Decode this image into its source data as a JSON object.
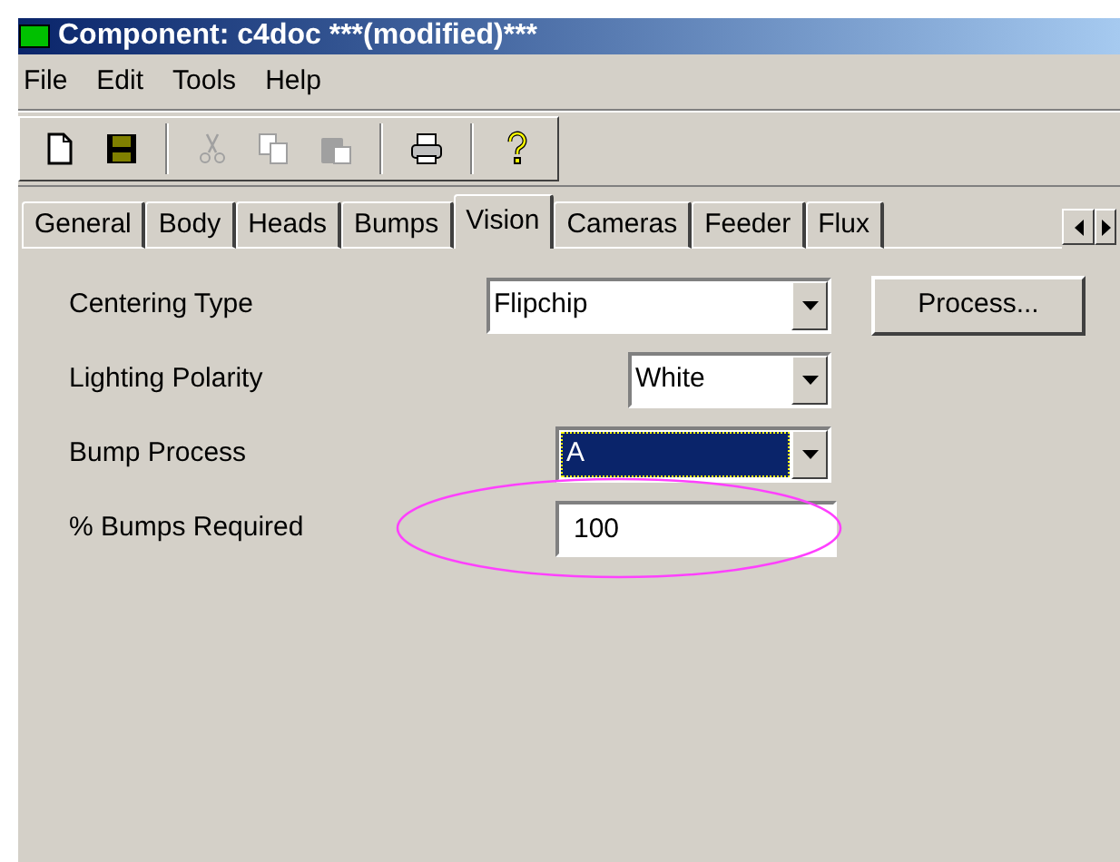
{
  "window": {
    "title": "Component: c4doc ***(modified)***"
  },
  "menu": [
    "File",
    "Edit",
    "Tools",
    "Help"
  ],
  "toolbar": [
    {
      "kind": "new",
      "disabled": false
    },
    {
      "kind": "save",
      "disabled": false
    },
    {
      "kind": "separator"
    },
    {
      "kind": "cut",
      "disabled": true
    },
    {
      "kind": "copy",
      "disabled": true
    },
    {
      "kind": "paste",
      "disabled": true
    },
    {
      "kind": "separator"
    },
    {
      "kind": "print",
      "disabled": false
    },
    {
      "kind": "separator"
    },
    {
      "kind": "help",
      "disabled": false
    }
  ],
  "tabs": [
    {
      "label": "General",
      "selected": false
    },
    {
      "label": "Body",
      "selected": false
    },
    {
      "label": "Heads",
      "selected": false
    },
    {
      "label": "Bumps",
      "selected": false
    },
    {
      "label": "Vision",
      "selected": true
    },
    {
      "label": "Cameras",
      "selected": false
    },
    {
      "label": "Feeder",
      "selected": false
    },
    {
      "label": "Flux",
      "selected": false
    }
  ],
  "fields": [
    {
      "label": "Centering Type",
      "kind": "combo",
      "value": "Flipchip",
      "focused": false
    },
    {
      "label": "Lighting Polarity",
      "kind": "combo",
      "value": "White",
      "focused": false
    },
    {
      "label": "Bump Process",
      "kind": "combo",
      "value": "A",
      "focused": true
    },
    {
      "label": "% Bumps Required",
      "kind": "text",
      "value": "100",
      "circled": true
    }
  ],
  "process_button": "Process..."
}
